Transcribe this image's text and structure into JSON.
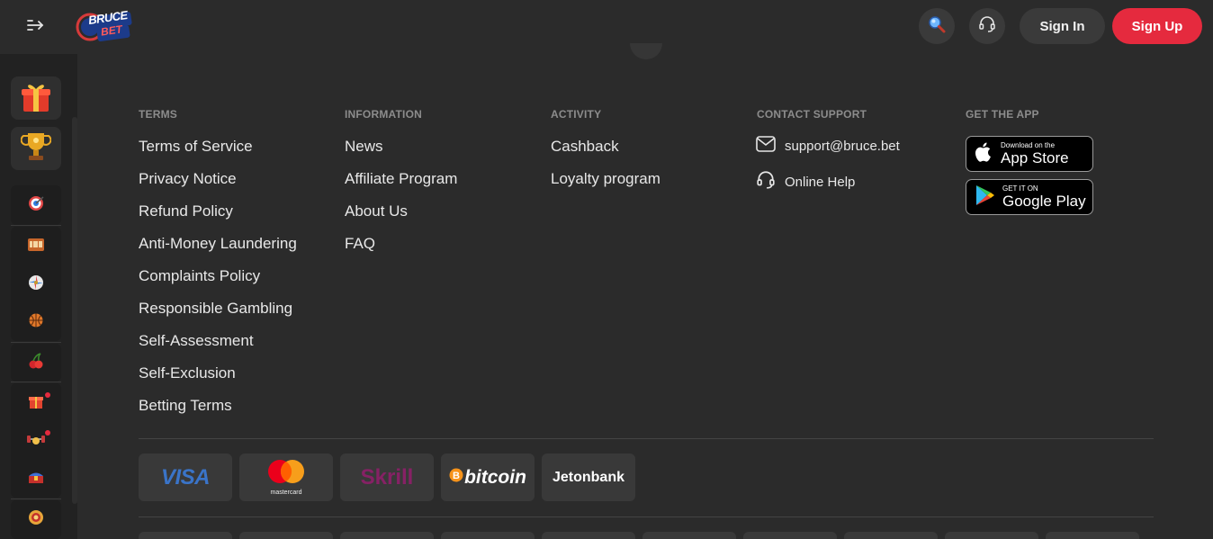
{
  "header": {
    "menu_icon": "expand-menu-icon",
    "logo_text_top": "BRUCE",
    "logo_text_bottom": "BET",
    "search_icon": "magnifier-icon",
    "support_icon": "headset-icon",
    "sign_in": "Sign In",
    "sign_up": "Sign Up"
  },
  "sidebar": {
    "promos": [
      {
        "icon": "gift-box-icon"
      },
      {
        "icon": "trophy-icon"
      }
    ],
    "items": [
      {
        "icon": "target-icon"
      },
      {
        "icon": "slot-machine-icon"
      },
      {
        "icon": "roulette-wheel-icon"
      },
      {
        "icon": "basketball-icon"
      },
      {
        "icon": "cherry-icon"
      },
      {
        "icon": "gift-icon",
        "badge": true
      },
      {
        "icon": "dumbbell-character-icon",
        "badge": true
      },
      {
        "icon": "treasure-chest-icon"
      },
      {
        "icon": "coin-emblem-icon"
      }
    ]
  },
  "footer": {
    "terms": {
      "heading": "TERMS",
      "links": [
        "Terms of Service",
        "Privacy Notice",
        "Refund Policy",
        "Anti-Money Laundering",
        "Complaints Policy",
        "Responsible Gambling",
        "Self-Assessment",
        "Self-Exclusion",
        "Betting Terms"
      ]
    },
    "information": {
      "heading": "INFORMATION",
      "links": [
        "News",
        "Affiliate Program",
        "About Us",
        "FAQ"
      ]
    },
    "activity": {
      "heading": "ACTIVITY",
      "links": [
        "Cashback",
        "Loyalty program"
      ]
    },
    "contact": {
      "heading": "CONTACT SUPPORT",
      "email": "support@bruce.bet",
      "online_help": "Online Help"
    },
    "app": {
      "heading": "GET THE APP",
      "app_store_small": "Download on the",
      "app_store_big": "App Store",
      "google_small": "GET IT ON",
      "google_big": "Google Play"
    },
    "payments": {
      "visa": "VISA",
      "mastercard": "mastercard",
      "skrill": "Skrill",
      "bitcoin": "bitcoin",
      "jetonbank": "Jetonbank"
    }
  },
  "colors": {
    "accent": "#e52a3e",
    "background": "#2b2b2b",
    "sidebar": "#222222",
    "tile": "#393939"
  }
}
